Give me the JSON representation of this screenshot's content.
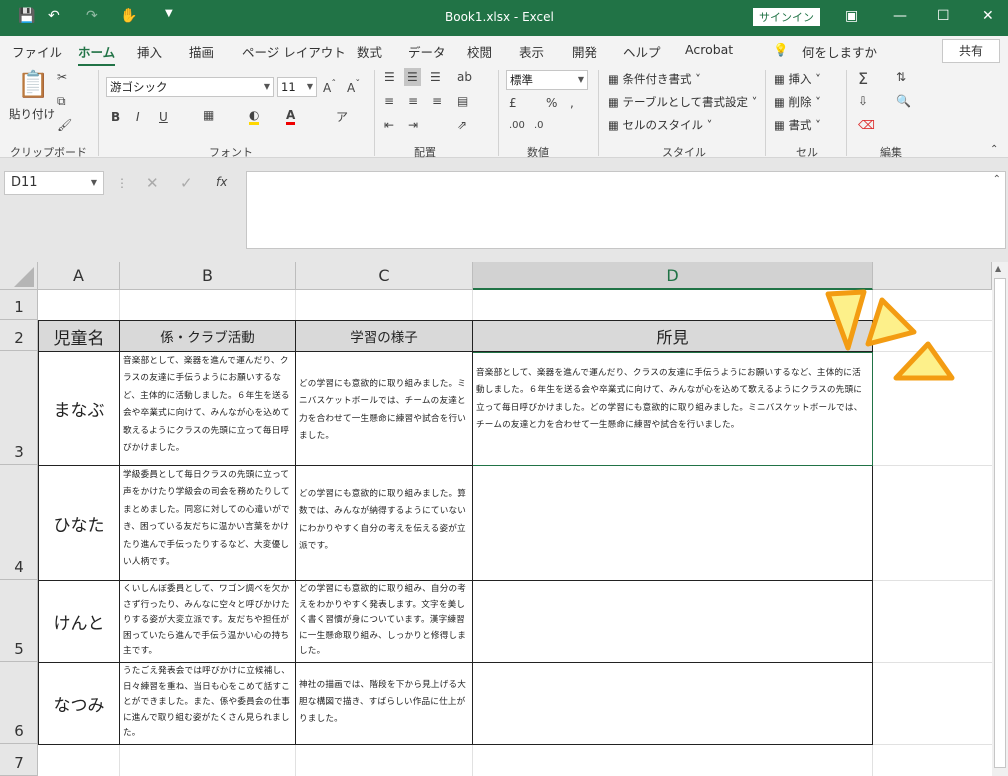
{
  "window": {
    "title": "Book1.xlsx  -  Excel",
    "signin": "サインイン"
  },
  "tabs": [
    "ファイル",
    "ホーム",
    "挿入",
    "描画",
    "ページ レイアウト",
    "数式",
    "データ",
    "校閲",
    "表示",
    "開発",
    "ヘルプ",
    "Acrobat",
    "何をしますか"
  ],
  "share": "共有",
  "ribbon": {
    "paste": "貼り付け",
    "clipboard": "クリップボード",
    "font_name": "游ゴシック",
    "font_size": "11",
    "font": "フォント",
    "alignment": "配置",
    "number_format": "標準",
    "number": "数値",
    "cond_format": "条件付き書式",
    "table_format": "テーブルとして書式設定",
    "cell_style": "セルのスタイル",
    "styles": "スタイル",
    "insert": "挿入",
    "delete": "削除",
    "format": "書式",
    "cells": "セル",
    "editing": "編集"
  },
  "formula_bar": {
    "name_box": "D11",
    "fx": "fx",
    "value": ""
  },
  "columns": [
    "A",
    "B",
    "C",
    "D"
  ],
  "rows": [
    "1",
    "2",
    "3",
    "4",
    "5",
    "6",
    "7"
  ],
  "headers": {
    "a": "児童名",
    "b": "係・クラブ活動",
    "c": "学習の様子",
    "d": "所見"
  },
  "students": [
    {
      "name": "まなぶ",
      "club": "音楽部として、楽器を進んで運んだり、クラスの友達に手伝うようにお願いするなど、主体的に活動しました。６年生を送る会や卒業式に向けて、みんなが心を込めて歌えるようにクラスの先頭に立って毎日呼びかけました。",
      "study": "どの学習にも意欲的に取り組みました。ミニバスケットボールでは、チームの友達と力を合わせて一生懸命に練習や試合を行いました。",
      "remark": "音楽部として、楽器を進んで運んだり、クラスの友達に手伝うようにお願いするなど、主体的に活動しました。６年生を送る会や卒業式に向けて、みんなが心を込めて歌えるようにクラスの先頭に立って毎日呼びかけました。どの学習にも意欲的に取り組みました。ミニバスケットボールでは、チームの友達と力を合わせて一生懸命に練習や試合を行いました。"
    },
    {
      "name": "ひなた",
      "club": "学級委員として毎日クラスの先頭に立って声をかけたり学級会の司会を務めたりしてまとめました。同窓に対しての心遣いができ、困っている友だちに温かい言葉をかけたり進んで手伝ったりするなど、大変優しい人柄です。",
      "study": "どの学習にも意欲的に取り組みました。算数では、みんなが納得するようにていないにわかりやすく自分の考えを伝える姿が立派です。",
      "remark": ""
    },
    {
      "name": "けんと",
      "club": "くいしんぼ委員として、ワゴン調べを欠かさず行ったり、みんなに空々と呼びかけたりする姿が大変立派です。友だちや担任が困っていたら進んで手伝う温かい心の持ち主です。",
      "study": "どの学習にも意欲的に取り組み、自分の考えをわかりやすく発表します。文字を美しく書く習慣が身についています。漢字練習に一生懸命取り組み、しっかりと修得しました。",
      "remark": ""
    },
    {
      "name": "なつみ",
      "club": "うたごえ発表会では呼びかけに立候補し、日々練習を重ね、当日も心をこめて話すことができました。また、係や委員会の仕事に進んで取り組む姿がたくさん見られました。",
      "study": "神社の描画では、階段を下から見上げる大胆な構図で描き、すばらしい作品に仕上がりました。",
      "remark": ""
    }
  ],
  "colors": {
    "excel_green": "#217346",
    "accent": "#f5a623"
  }
}
